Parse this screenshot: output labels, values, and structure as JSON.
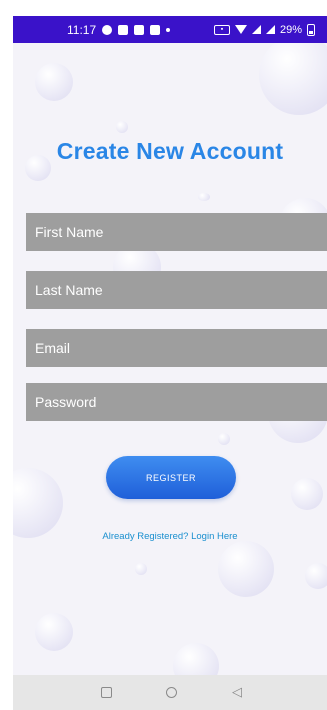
{
  "status_bar": {
    "time": "11:17",
    "battery": "29%"
  },
  "page": {
    "title": "Create New Account"
  },
  "form": {
    "first_name_placeholder": "First Name",
    "last_name_placeholder": "Last Name",
    "email_placeholder": "Email",
    "password_placeholder": "Password",
    "register_label": "Register"
  },
  "login_link": "Already Registered? Login Here",
  "colors": {
    "status_bar": "#3a12c9",
    "title": "#2a86e6",
    "field_bg": "#9e9e9e",
    "button": "#2a6fe3",
    "link": "#1a8fcf"
  }
}
